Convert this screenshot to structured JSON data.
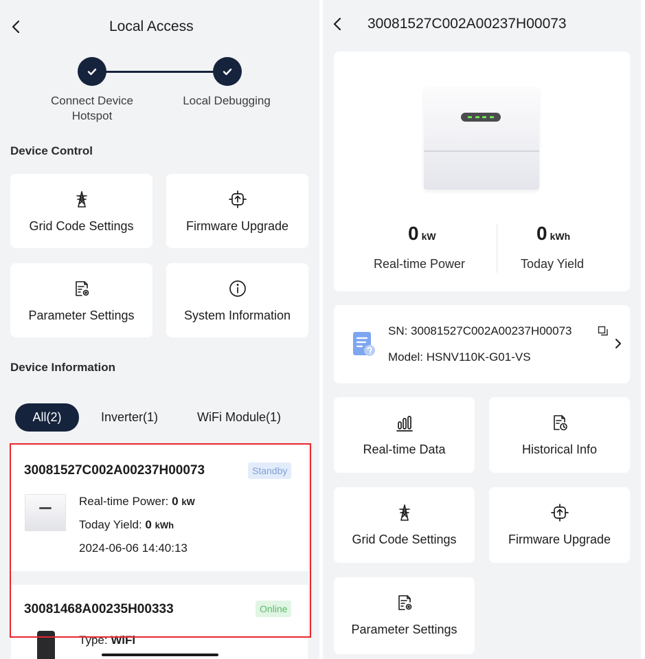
{
  "left": {
    "title": "Local Access",
    "steps": [
      {
        "label_line1": "Connect Device",
        "label_line2": "Hotspot"
      },
      {
        "label_line1": "Local Debugging",
        "label_line2": ""
      }
    ],
    "device_control_title": "Device Control",
    "controls": [
      {
        "label": "Grid Code Settings",
        "icon": "grid-tower-icon"
      },
      {
        "label": "Firmware Upgrade",
        "icon": "firmware-upgrade-icon"
      },
      {
        "label": "Parameter Settings",
        "icon": "parameter-settings-icon"
      },
      {
        "label": "System Information",
        "icon": "info-icon"
      }
    ],
    "device_info_title": "Device Information",
    "filters": [
      "All(2)",
      "Inverter(1)",
      "WiFi Module(1)"
    ],
    "devices": [
      {
        "sn": "30081527C002A00237H00073",
        "status": "Standby",
        "power_label": "Real-time Power:",
        "power_value": "0",
        "power_unit": "kW",
        "yield_label": "Today Yield:",
        "yield_value": "0",
        "yield_unit": "kWh",
        "timestamp": "2024-06-06 14:40:13"
      },
      {
        "sn": "30081468A00235H00333",
        "status": "Online",
        "type_label": "Type:",
        "type_value": "WiFi"
      }
    ],
    "colors": {
      "navy": "#16233d",
      "highlight": "#e8252d"
    }
  },
  "right": {
    "title": "30081527C002A00237H00073",
    "metrics": [
      {
        "value": "0",
        "unit": "kW",
        "label": "Real-time Power"
      },
      {
        "value": "0",
        "unit": "kWh",
        "label": "Today Yield"
      }
    ],
    "sn_line": "SN: 30081527C002A00237H00073",
    "model_line": "Model: HSNV110K-G01-VS",
    "tiles": [
      {
        "label": "Real-time Data",
        "icon": "bar-chart-icon"
      },
      {
        "label": "Historical Info",
        "icon": "history-document-icon"
      },
      {
        "label": "Grid Code Settings",
        "icon": "grid-tower-icon"
      },
      {
        "label": "Firmware Upgrade",
        "icon": "firmware-upgrade-icon"
      },
      {
        "label": "Parameter Settings",
        "icon": "parameter-settings-icon"
      }
    ]
  }
}
